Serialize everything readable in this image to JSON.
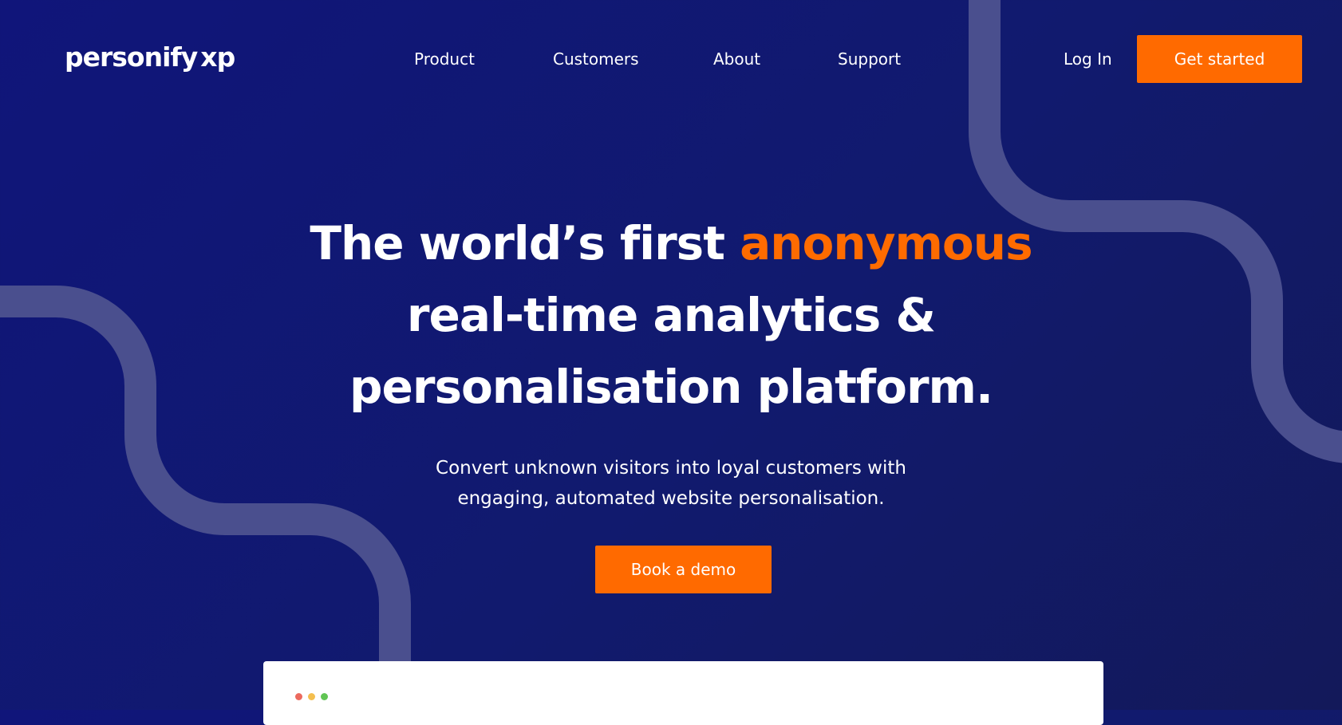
{
  "brand": {
    "name": "personify",
    "suffix_x": "x",
    "suffix_p": "p",
    "accent_color": "#ff6b00",
    "background_color": "#10157a"
  },
  "nav": {
    "items": [
      "Product",
      "Customers",
      "About",
      "Support"
    ],
    "login": "Log In",
    "cta": "Get started"
  },
  "hero": {
    "title_part1": "The world’s first ",
    "title_highlight": "anonymous",
    "title_line2": "real-time analytics &",
    "title_line3": "personalisation platform.",
    "subtitle_line1": "Convert unknown visitors into loyal customers with",
    "subtitle_line2": "engaging, automated website personalisation.",
    "cta": "Book a demo"
  },
  "preview": {
    "window_dot_colors": [
      "#ec6a5e",
      "#f4bf4f",
      "#61c554"
    ]
  }
}
